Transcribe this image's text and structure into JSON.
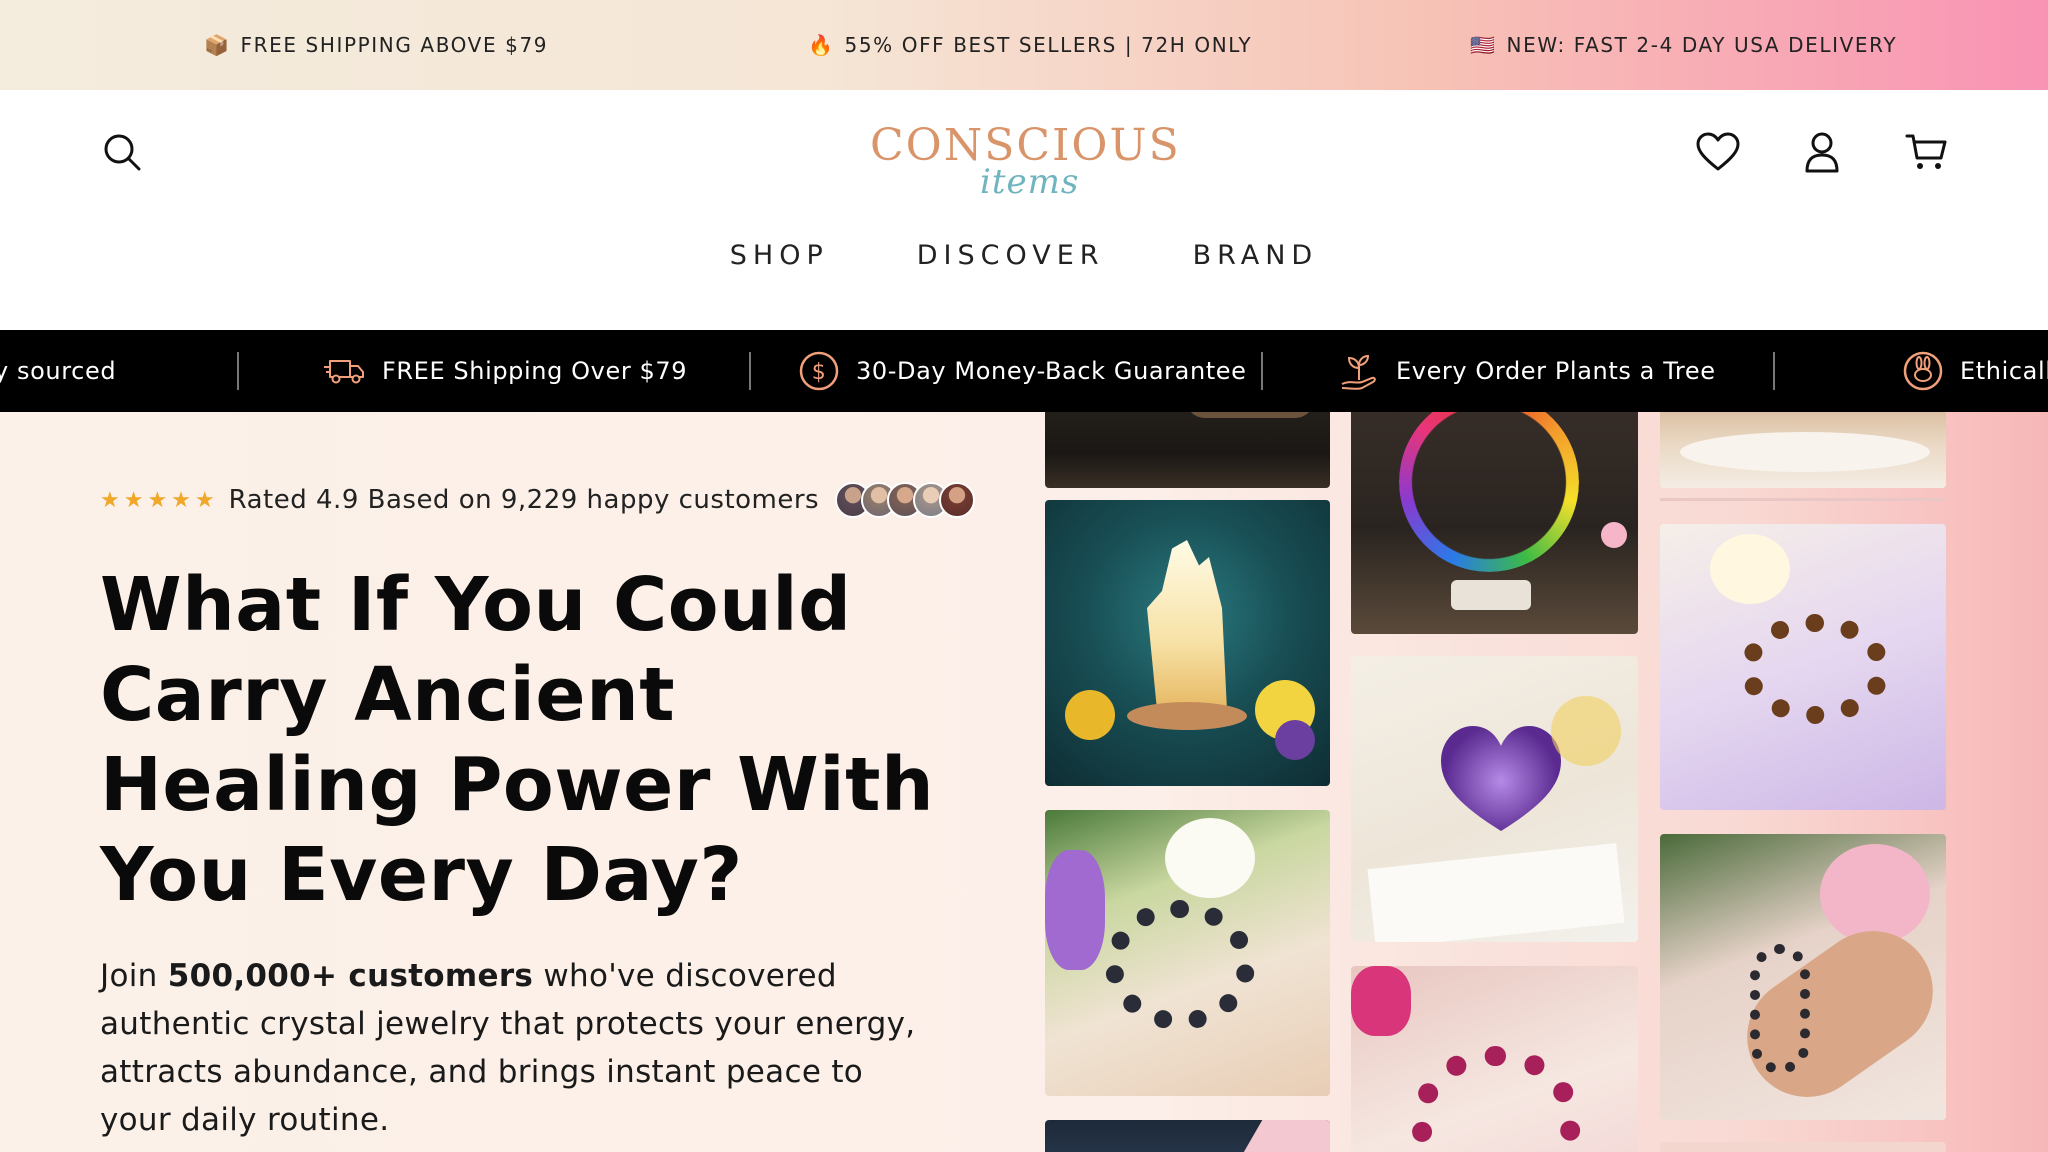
{
  "announcement": {
    "items": [
      {
        "emoji": "📦",
        "text": "FREE SHIPPING ABOVE $79"
      },
      {
        "emoji": "🔥",
        "text": "55% OFF BEST SELLERS | 72H ONLY"
      },
      {
        "emoji": "🇺🇸",
        "text": "NEW: FAST 2-4 DAY USA DELIVERY"
      }
    ]
  },
  "header": {
    "logo_main": "CONSCIOUS",
    "logo_sub": "items",
    "nav": [
      "SHOP",
      "DISCOVER",
      "BRAND"
    ],
    "icons": [
      "search-icon",
      "heart-icon",
      "account-icon",
      "cart-icon"
    ]
  },
  "trust_bar": {
    "items": [
      {
        "icon": "leaf-icon",
        "text": "sourced",
        "partial": "y sourced"
      },
      {
        "icon": "truck-icon",
        "text": "FREE Shipping Over $79"
      },
      {
        "icon": "dollar-icon",
        "text": "30-Day Money-Back Guarantee"
      },
      {
        "icon": "plant-icon",
        "text": "Every Order Plants a Tree"
      },
      {
        "icon": "bunny-icon",
        "text": "Ethically"
      }
    ]
  },
  "hero": {
    "stars": "★★★★★",
    "rating_text": "Rated 4.9 Based on 9,229 happy customers",
    "headline": "What If You Could Carry Ancient Healing Power With You Every Day?",
    "sub_prefix": "Join ",
    "sub_bold": "500,000+ customers",
    "sub_rest": " who've discovered authentic crystal jewelry that protects your energy, attracts abundance, and brings instant peace to your daily routine."
  },
  "colors": {
    "star": "#f0a82a",
    "logo_main": "#d9946a",
    "logo_sub": "#6fb4bf"
  }
}
